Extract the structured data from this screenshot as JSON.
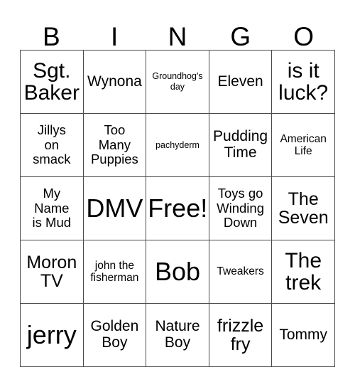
{
  "card": {
    "header_letters": [
      "B",
      "I",
      "N",
      "G",
      "O"
    ],
    "rows": [
      [
        {
          "text": "Sgt.\nBaker",
          "size": "xl"
        },
        {
          "text": "Wynona",
          "size": "ml"
        },
        {
          "text": "Groundhog's\nday",
          "size": "xs"
        },
        {
          "text": "Eleven",
          "size": "ml"
        },
        {
          "text": "is it\nluck?",
          "size": "xl"
        }
      ],
      [
        {
          "text": "Jillys\non\nsmack",
          "size": "m"
        },
        {
          "text": "Too\nMany\nPuppies",
          "size": "m"
        },
        {
          "text": "pachyderm",
          "size": "xs"
        },
        {
          "text": "Pudding\nTime",
          "size": "ml"
        },
        {
          "text": "American\nLife",
          "size": "s"
        }
      ],
      [
        {
          "text": "My\nName\nis Mud",
          "size": "m"
        },
        {
          "text": "DMV",
          "size": "xxl"
        },
        {
          "text": "Free!",
          "size": "xxl"
        },
        {
          "text": "Toys go\nWinding\nDown",
          "size": "m"
        },
        {
          "text": "The\nSeven",
          "size": "l"
        }
      ],
      [
        {
          "text": "Moron\nTV",
          "size": "l"
        },
        {
          "text": "john the\nfisherman",
          "size": "s"
        },
        {
          "text": "Bob",
          "size": "xxl"
        },
        {
          "text": "Tweakers",
          "size": "s"
        },
        {
          "text": "The\ntrek",
          "size": "xl"
        }
      ],
      [
        {
          "text": "jerry",
          "size": "xxl"
        },
        {
          "text": "Golden\nBoy",
          "size": "ml"
        },
        {
          "text": "Nature\nBoy",
          "size": "ml"
        },
        {
          "text": "frizzle\nfry",
          "size": "l"
        },
        {
          "text": "Tommy",
          "size": "ml"
        }
      ]
    ]
  },
  "colors": {
    "background": "#ffffff",
    "text": "#000000",
    "grid_line": "#4a4a4a"
  }
}
